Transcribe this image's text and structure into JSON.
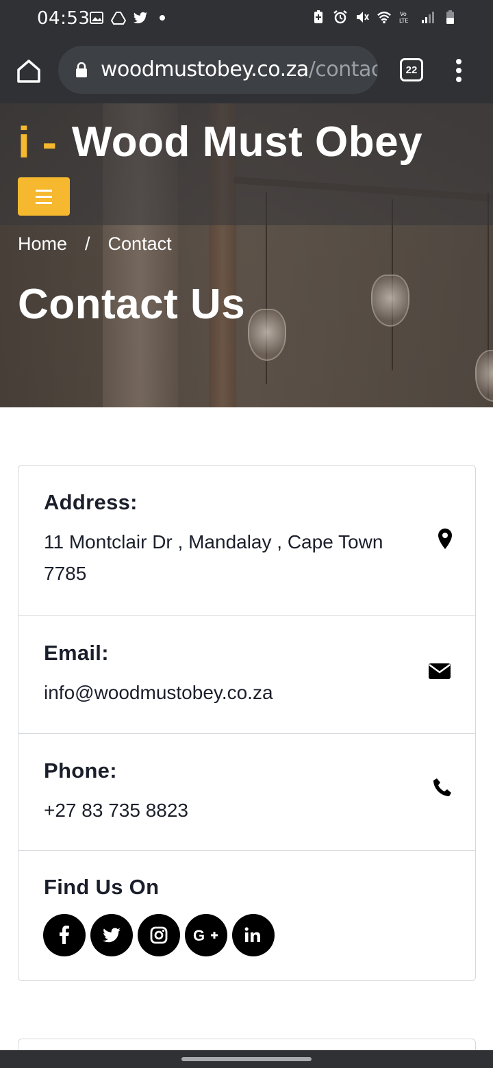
{
  "status_bar": {
    "time": "04:53",
    "left_icons": [
      "image-icon",
      "drive-icon",
      "twitter-icon",
      "dot-icon"
    ],
    "right_icons": [
      "battery-saver-icon",
      "alarm-icon",
      "mute-icon",
      "wifi-icon",
      "volte-icon",
      "signal-icon",
      "battery-icon"
    ]
  },
  "browser": {
    "url_host": "woodmustobey.co.za",
    "url_path": "/contac",
    "tab_count": "22"
  },
  "header": {
    "brand_icon": "i -",
    "brand_name": "Wood Must Obey",
    "accent_color": "#f5b82e"
  },
  "breadcrumb": {
    "home": "Home",
    "separator": "/",
    "current": "Contact"
  },
  "page_title": "Contact Us",
  "contact": {
    "address_label": "Address:",
    "address_line1": "11 Montclair Dr , Mandalay , Cape Town",
    "address_line2": "7785",
    "email_label": "Email:",
    "email_value": "info@woodmustobey.co.za",
    "phone_label": "Phone:",
    "phone_value": "+27 83 735 8823",
    "social_label": "Find Us On",
    "social": [
      {
        "icon": "facebook-icon",
        "glyph": "f"
      },
      {
        "icon": "twitter-icon",
        "glyph": "t"
      },
      {
        "icon": "instagram-icon",
        "glyph": "ig"
      },
      {
        "icon": "google-plus-icon",
        "glyph": "G+"
      },
      {
        "icon": "linkedin-icon",
        "glyph": "in"
      }
    ]
  }
}
